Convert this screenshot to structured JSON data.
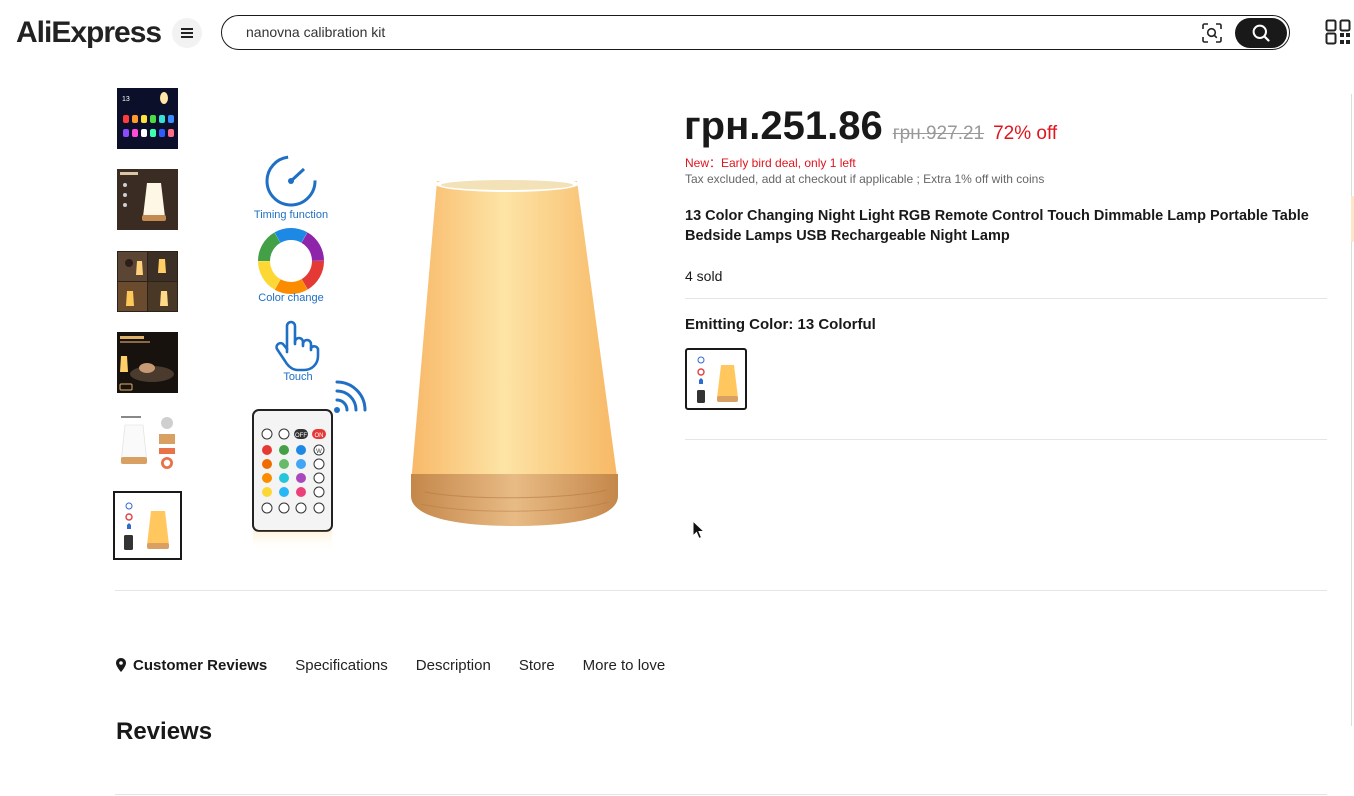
{
  "header": {
    "logo_text": "AliExpress",
    "search": {
      "value": "nanovna calibration kit",
      "placeholder": ""
    },
    "icons": [
      "menu-icon",
      "image-search-icon",
      "search-icon",
      "qr-code-icon"
    ]
  },
  "gallery": {
    "thumbnails": [
      {
        "name": "thumb-colors",
        "badge": "13"
      },
      {
        "name": "thumb-features"
      },
      {
        "name": "thumb-lifestyle"
      },
      {
        "name": "thumb-bedroom"
      },
      {
        "name": "thumb-dimensions"
      },
      {
        "name": "thumb-remote",
        "selected": true
      }
    ],
    "main_image": {
      "features": [
        {
          "label": "Timing function",
          "icon": "clock-icon"
        },
        {
          "label": "Color change",
          "icon": "color-wheel-icon"
        },
        {
          "label": "Touch",
          "icon": "touch-hand-icon"
        }
      ],
      "remote_buttons": [
        "OFF",
        "ON",
        "W"
      ]
    }
  },
  "product": {
    "price": "грн.251.86",
    "old_price": "грн.927.21",
    "discount": "72% off",
    "promo": "New：Early bird deal, only 1 left",
    "tax_note": "Tax excluded, add at checkout if applicable ; Extra 1% off with coins",
    "title": "13 Color Changing Night Light RGB Remote Control Touch Dimmable Lamp Portable Table Bedside Lamps USB Rechargeable Night Lamp",
    "sold": "4 sold",
    "color_label": "Emitting Color: 13 Colorful"
  },
  "tabs": [
    {
      "label": "Customer Reviews",
      "active": true
    },
    {
      "label": "Specifications"
    },
    {
      "label": "Description"
    },
    {
      "label": "Store"
    },
    {
      "label": "More to love"
    }
  ],
  "reviews": {
    "heading": "Reviews"
  },
  "colors": {
    "accent_red": "#e0141e",
    "text_dark": "#191919",
    "muted": "#999999",
    "lamp_glow": "#f9c46a",
    "wood": "#d9a063"
  }
}
